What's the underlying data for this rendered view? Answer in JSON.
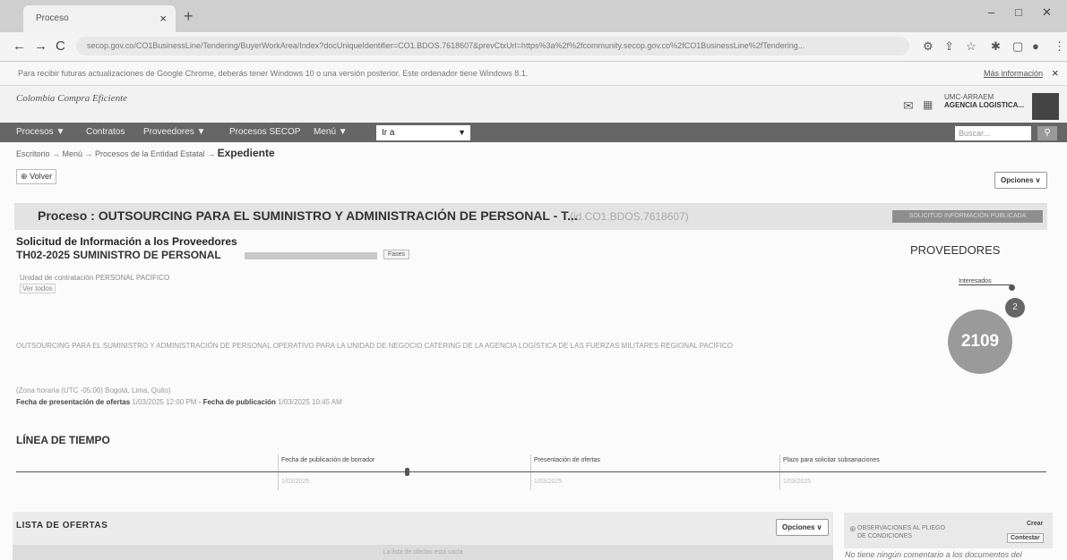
{
  "browser": {
    "tab_title": "Proceso",
    "tab_close": "×",
    "new_tab": "+",
    "controls": {
      "minimize": "–",
      "maximize": "□",
      "close": "✕"
    },
    "back": "←",
    "forward": "→",
    "reload": "C",
    "url": "secop.gov.co/CO1BusinessLine/Tendering/BuyerWorkArea/Index?docUniqueIdentifier=CO1.BDOS.7618607&prevCtxUrl=https%3a%2f%2fcommunity.secop.gov.co%2fCO1BusinessLine%2fTendering..."
  },
  "infobar": {
    "message": "Para recibir futuras actualizaciones de Google Chrome, deberás tener Windows 10 o una versión posterior. Este ordenador tiene Windows 8.1.",
    "link": "Más información",
    "close": "×"
  },
  "site": {
    "logo": "Colombia Compra Eficiente",
    "user_name": "UMC-ARRAEM",
    "org": "AGENCIA LOGISTICA..."
  },
  "nav": {
    "items": [
      "Procesos ▼",
      "Contratos",
      "Proveedores ▼",
      "Procesos SECOP",
      "Menú ▼"
    ],
    "goto": "Ir a",
    "search_placeholder": "Buscar..."
  },
  "breadcrumb": {
    "path": "Escritorio → Menú → Procesos de la Entidad Estatal →",
    "current": "Expediente"
  },
  "back_button": "Volver",
  "options_label": "Opciones ∨",
  "process": {
    "title": "Proceso : OUTSOURCING PARA EL SUMINISTRO Y ADMINISTRACIÓN DE PERSONAL - T...",
    "id": "(id.CO1.BDOS.7618607)",
    "status": "SOLICITUD INFORMACIÓN PUBLICADA"
  },
  "request": {
    "heading": "Solicitud de Información a los Proveedores",
    "reference": "TH02-2025 SUMINISTRO DE PERSONAL",
    "phase_button": "Fases",
    "unit": "Unidad de contratación PERSONAL PACIFICO",
    "see_more": "Ver todos",
    "description": "OUTSOURCING PARA EL SUMINISTRO Y ADMINISTRACIÓN DE PERSONAL OPERATIVO PARA LA UNIDAD DE NEGOCIO CATERING DE LA AGENCIA LOGÍSTICA DE LAS FUERZAS MILITARES REGIONAL PACIFICO",
    "timezone": "(Zona horaria (UTC -05:00) Bogotá, Lima, Quito)",
    "dates_label_1": "Fecha de presentación de ofertas",
    "dates_value_1": "1/03/2025 12:00 PM",
    "dates_label_2": "Fecha de publicación",
    "dates_value_2": "1/03/2025 10:45 AM"
  },
  "providers": {
    "title": "PROVEEDORES",
    "link": "Interesados",
    "badge": "2",
    "count": "2109"
  },
  "timeline": {
    "title": "LÍNEA DE TIEMPO",
    "items": [
      {
        "label": "Fecha de publicación de borrador",
        "sub": "1/03/2025"
      },
      {
        "label": "Presentación de ofertas",
        "sub": "1/03/2025"
      },
      {
        "label": "Plazo para solicitar subsanaciones",
        "sub": "1/03/2025"
      }
    ]
  },
  "offers": {
    "title": "LISTA DE OFERTAS",
    "options": "Opciones ∨",
    "empty": "La lista de ofertas está vacía"
  },
  "observations": {
    "title": "OBSERVACIONES AL PLIEGO DE CONDICIONES",
    "create": "Crear",
    "reply": "Contestar",
    "note": "No tiene ningún comentario a los documentos del"
  }
}
